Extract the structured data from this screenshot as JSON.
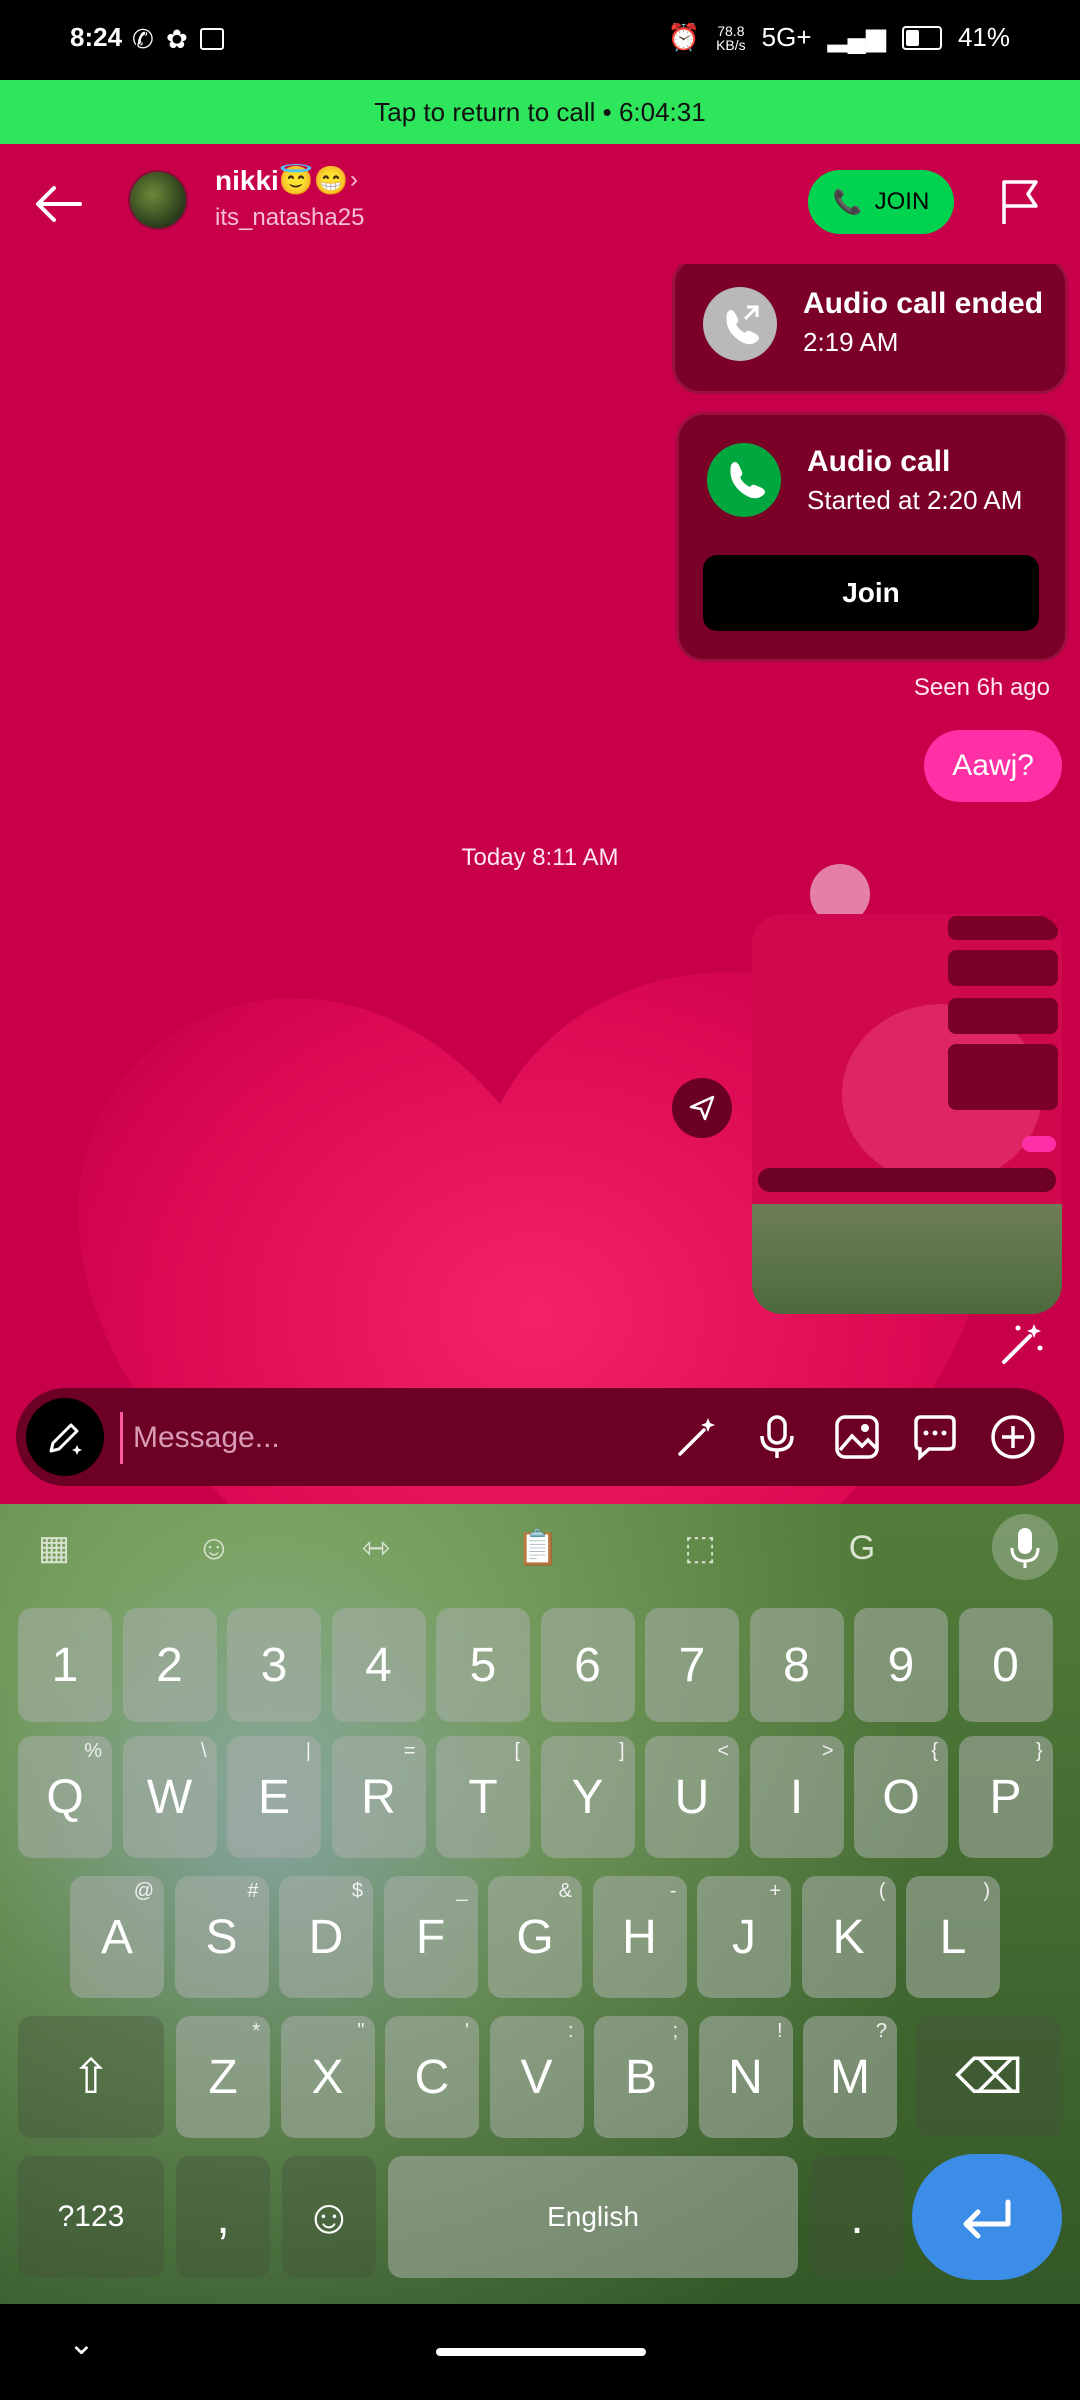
{
  "status_bar": {
    "time": "8:24",
    "speed_top": "78.8",
    "speed_unit": "KB/s",
    "network": "5G+",
    "battery": "41%",
    "battery_level": 0.41
  },
  "call_banner": {
    "text": "Tap to return to call • 6:04:31"
  },
  "header": {
    "name": "nikki😇😁",
    "username": "its_natasha25",
    "join_label": "JOIN"
  },
  "messages": {
    "ended_title": "Audio call ended",
    "ended_time": "2:19 AM",
    "call_title": "Audio call",
    "call_sub": "Started at 2:20 AM",
    "join_button": "Join",
    "seen": "Seen 6h ago",
    "sent_text": "Aawj?",
    "date_divider": "Today 8:11 AM"
  },
  "composer": {
    "placeholder": "Message..."
  },
  "keyboard": {
    "number_row": [
      "1",
      "2",
      "3",
      "4",
      "5",
      "6",
      "7",
      "8",
      "9",
      "0"
    ],
    "row1": [
      {
        "k": "Q",
        "h": "%"
      },
      {
        "k": "W",
        "h": "\\"
      },
      {
        "k": "E",
        "h": "|"
      },
      {
        "k": "R",
        "h": "="
      },
      {
        "k": "T",
        "h": "["
      },
      {
        "k": "Y",
        "h": "]"
      },
      {
        "k": "U",
        "h": "<"
      },
      {
        "k": "I",
        "h": ">"
      },
      {
        "k": "O",
        "h": "{"
      },
      {
        "k": "P",
        "h": "}"
      }
    ],
    "row2": [
      {
        "k": "A",
        "h": "@"
      },
      {
        "k": "S",
        "h": "#"
      },
      {
        "k": "D",
        "h": "$"
      },
      {
        "k": "F",
        "h": "_"
      },
      {
        "k": "G",
        "h": "&"
      },
      {
        "k": "H",
        "h": "-"
      },
      {
        "k": "J",
        "h": "+"
      },
      {
        "k": "K",
        "h": "("
      },
      {
        "k": "L",
        "h": ")"
      }
    ],
    "row3": [
      {
        "k": "Z",
        "h": "*"
      },
      {
        "k": "X",
        "h": "\""
      },
      {
        "k": "C",
        "h": "'"
      },
      {
        "k": "V",
        "h": ":"
      },
      {
        "k": "B",
        "h": ";"
      },
      {
        "k": "N",
        "h": "!"
      },
      {
        "k": "M",
        "h": "?"
      }
    ],
    "symbols_label": "?123",
    "comma": ",",
    "space_label": "English",
    "period": "."
  }
}
